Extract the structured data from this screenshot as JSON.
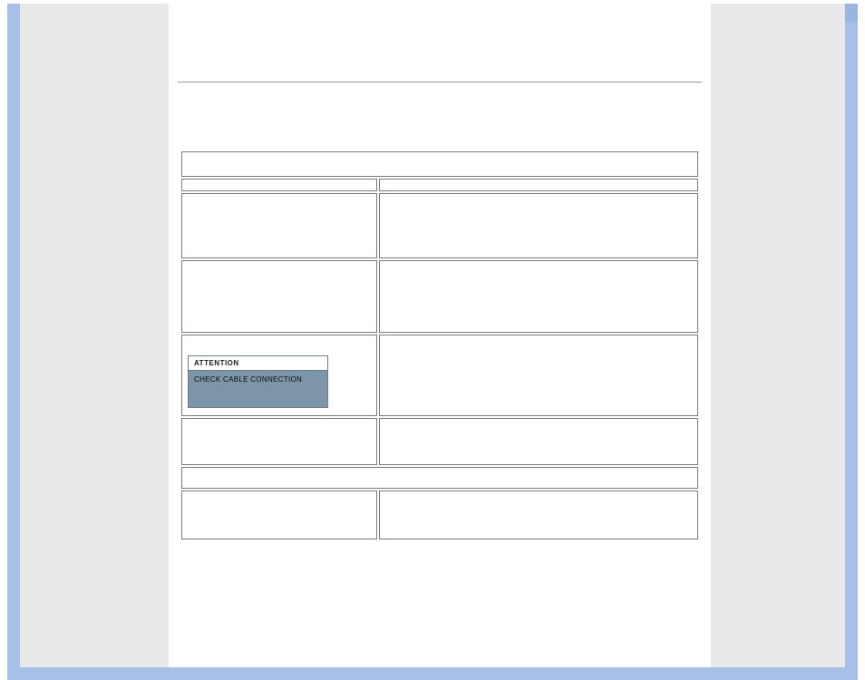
{
  "attention_panel": {
    "title": "ATTENTION",
    "message": "CHECK CABLE CONNECTION"
  },
  "table": {
    "rows": [
      {
        "kind": "hdr",
        "span": "full",
        "cells": [
          ""
        ]
      },
      {
        "kind": "sub",
        "span": "split",
        "cells": [
          "",
          ""
        ]
      },
      {
        "kind": "body",
        "span": "split",
        "cells": [
          "",
          ""
        ]
      },
      {
        "kind": "body2",
        "span": "split",
        "cells": [
          "",
          ""
        ]
      },
      {
        "kind": "body3",
        "span": "split",
        "cells": [
          "__ATTENTION__",
          ""
        ]
      },
      {
        "kind": "short",
        "span": "split",
        "cells": [
          "",
          ""
        ]
      },
      {
        "kind": "sep",
        "span": "full",
        "cells": [
          ""
        ]
      },
      {
        "kind": "tail",
        "span": "split",
        "cells": [
          "",
          ""
        ]
      }
    ]
  }
}
